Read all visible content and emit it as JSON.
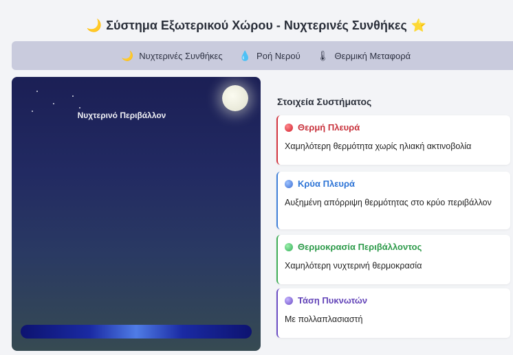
{
  "header": {
    "moon_icon": "🌙",
    "title": "Σύστημα Εξωτερικού Χώρου - Νυχτερινές Συνθήκες",
    "star_icon": "⭐"
  },
  "nav": {
    "items": [
      {
        "icon": "🌙",
        "label": "Νυχτερινές Συνθήκες"
      },
      {
        "icon": "💧",
        "label": "Ροή Νερού"
      },
      {
        "icon": "🌡",
        "label": "Θερμική Μεταφορά"
      }
    ]
  },
  "scene": {
    "label": "Νυχτερινό Περιβάλλον"
  },
  "panel": {
    "title": "Στοιχεία Συστήματος",
    "cards": [
      {
        "title": "Θερμή Πλευρά",
        "desc": "Χαμηλότερη θερμότητα χωρίς ηλιακή ακτινοβολία",
        "color": "#d2343f"
      },
      {
        "title": "Κρύα Πλευρά",
        "desc": "Αυξημένη απόρριψη θερμότητας στο κρύο περιβάλλον",
        "color": "#3f7fd8"
      },
      {
        "title": "Θερμοκρασία Περιβάλλοντος",
        "desc": "Χαμηλότερη νυχτερινή θερμοκρασία",
        "color": "#3fae56"
      },
      {
        "title": "Τάση Πυκνωτών",
        "desc": "Με πολλαπλασιαστή",
        "color": "#6a4cc3"
      }
    ]
  }
}
